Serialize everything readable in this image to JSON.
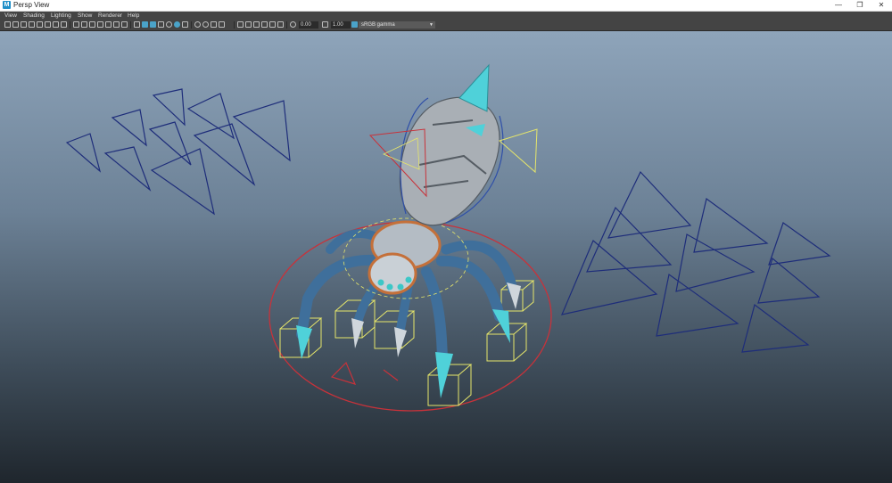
{
  "window": {
    "title": "Persp View",
    "app_icon_letter": "M"
  },
  "menu": [
    "View",
    "Shading",
    "Lighting",
    "Show",
    "Renderer",
    "Help"
  ],
  "toolbar": {
    "exposure_value": "0.00",
    "gamma_value": "1.00",
    "color_space": "sRGB gamma"
  },
  "colors": {
    "viewport_top": "#8ea4ba",
    "viewport_bottom": "#1f262d",
    "manipulator_yellow": "#e6e66a",
    "control_red": "#c8323a",
    "camera_blue": "#1e2d7a",
    "accent_cyan": "#4fd1d9"
  }
}
